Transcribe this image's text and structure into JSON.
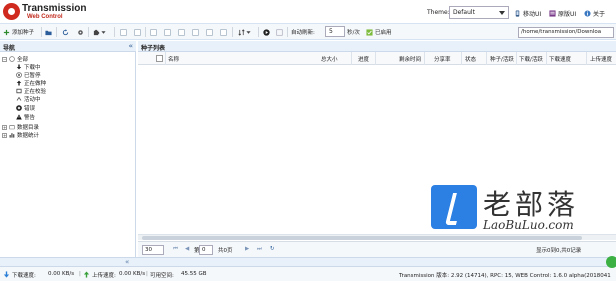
{
  "header": {
    "logo_title": "Transmission",
    "logo_subtitle": "Web Control",
    "theme_label": "Theme:",
    "theme_value": "Default",
    "links": [
      {
        "label": "移动UI",
        "icon": "mobile-icon"
      },
      {
        "label": "原版UI",
        "icon": "original-ui-icon"
      },
      {
        "label": "关于",
        "icon": "info-icon"
      }
    ]
  },
  "toolbar": {
    "add_label": "添加种子",
    "auto_refresh_label": "自动刷新:",
    "auto_refresh_value": "5",
    "interval_unit": "秒/次",
    "enabled_label": "已启用",
    "path_value": "/home/transmission/Downloa"
  },
  "nav": {
    "title": "导航",
    "tree": [
      {
        "label": "全部",
        "icon": "all-icon"
      },
      {
        "label": "下载中",
        "icon": "download-icon"
      },
      {
        "label": "已暂停",
        "icon": "pause-icon"
      },
      {
        "label": "正在做种",
        "icon": "seeding-icon"
      },
      {
        "label": "正在校验",
        "icon": "verify-icon"
      },
      {
        "label": "活动中",
        "icon": "active-icon"
      },
      {
        "label": "错误",
        "icon": "error-icon"
      },
      {
        "label": "警告",
        "icon": "warning-icon"
      },
      {
        "label": "数据目录",
        "icon": "folder-icon"
      },
      {
        "label": "数据统计",
        "icon": "stats-icon"
      }
    ]
  },
  "list": {
    "title": "种子列表",
    "columns": [
      "名称",
      "总大小",
      "进度",
      "剩余时间",
      "分享率",
      "状态",
      "种子/活跃",
      "下载/活跃",
      "下载速度",
      "上传速度"
    ]
  },
  "pager": {
    "page_size": "30",
    "page_prefix": "第",
    "page_value": "0",
    "page_total": "共0页",
    "summary": "显示0到0,共0记录"
  },
  "status": {
    "download_label": "下载速度:",
    "download_value": "0.00 KB/s",
    "upload_label": "上传速度:",
    "upload_value": "0.00 KB/s",
    "free_label": "可用空间:",
    "free_value": "45.55 GB",
    "version_text": "Transmission 版本: 2.92 (14714), RPC: 15, WEB Control: 1.6.0 alpha(2018041"
  },
  "watermark": {
    "cn": "老部落",
    "en": "LaoBuLuo.com"
  },
  "colors": {
    "accent": "#2c7fe3",
    "panel_header": "#e8f0f9",
    "border": "#cbd9ea",
    "logo_red": "#d02a1e"
  }
}
